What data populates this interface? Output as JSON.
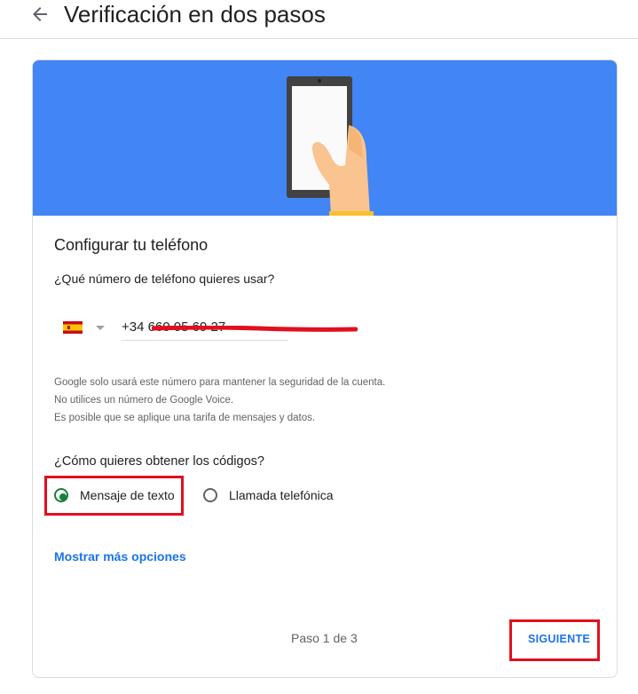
{
  "header": {
    "title": "Verificación en dos pasos",
    "back_icon": "arrow-left-icon"
  },
  "colors": {
    "banner": "#4285f4",
    "link": "#1a73e8",
    "radio_checked": "#188038",
    "highlight": "#e0101f"
  },
  "card": {
    "title": "Configurar tu teléfono",
    "phone_question": "¿Qué número de teléfono quieres usar?",
    "country": {
      "flag_icon": "spain-flag-icon"
    },
    "phone_value": "+34 660 05 69 27",
    "notes": [
      "Google solo usará este número para mantener la seguridad de la cuenta.",
      "No utilices un número de Google Voice.",
      "Es posible que se aplique una tarifa de mensajes y datos."
    ],
    "codes_question": "¿Cómo quieres obtener los códigos?",
    "options": [
      {
        "label": "Mensaje de texto",
        "selected": true
      },
      {
        "label": "Llamada telefónica",
        "selected": false
      }
    ],
    "more_options": "Mostrar más opciones",
    "step": "Paso 1 de 3",
    "next": "SIGUIENTE"
  }
}
